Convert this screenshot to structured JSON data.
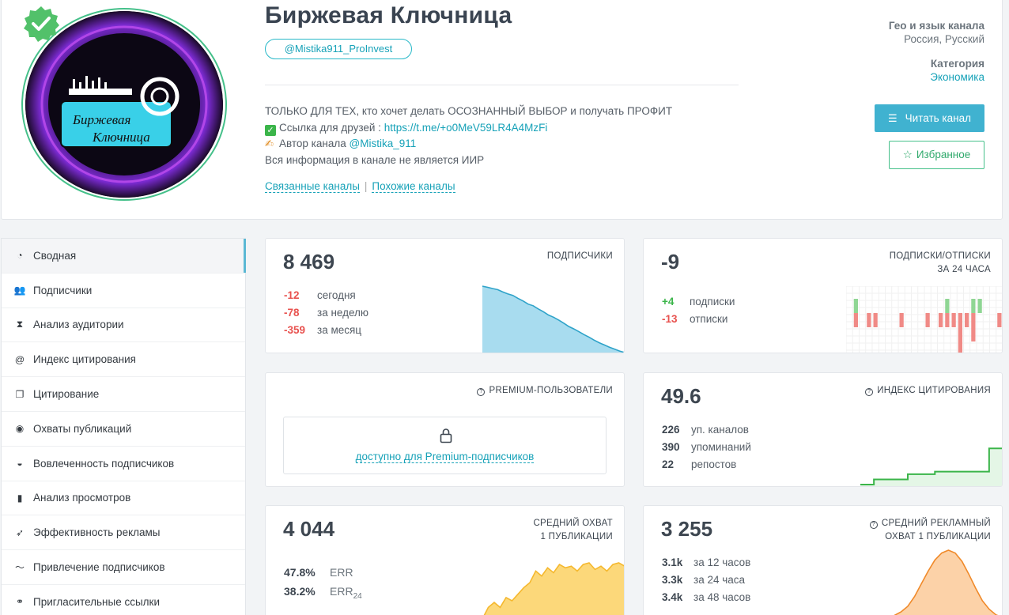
{
  "channel": {
    "title": "Биржевая Ключница",
    "username": "@Mistika911_ProInvest",
    "avatar_text_line1": "Биржевая",
    "avatar_text_line2": "Ключница",
    "description": {
      "line1": "ТОЛЬКО ДЛЯ ТЕХ, кто хочет делать  ОСОЗНАННЫЙ ВЫБОР и получать ПРОФИТ",
      "line2_label": "Ссылка для друзей : ",
      "line2_link": "https://t.me/+o0MeV59LR4A4MzFi",
      "line3_label": "Автор канала ",
      "line3_link": "@Mistika_911",
      "line4": "Вся информация в канале не является ИИР"
    },
    "related_label": "Связанные каналы",
    "similar_label": "Похожие каналы",
    "sep": "|"
  },
  "meta": {
    "geo_label": "Гео и язык канала",
    "geo_value": "Россия, Русский",
    "category_label": "Категория",
    "category_value": "Экономика"
  },
  "buttons": {
    "read": "Читать канал",
    "favorite": "Избранное"
  },
  "sidebar": {
    "items": [
      {
        "label": "Сводная",
        "icon": "dashboard-icon"
      },
      {
        "label": "Подписчики",
        "icon": "users-icon"
      },
      {
        "label": "Анализ аудитории",
        "icon": "hourglass-icon"
      },
      {
        "label": "Индекс цитирования",
        "icon": "at-icon"
      },
      {
        "label": "Цитирование",
        "icon": "quote-icon"
      },
      {
        "label": "Охваты публикаций",
        "icon": "eye-icon"
      },
      {
        "label": "Вовлеченность подписчиков",
        "icon": "engagement-icon"
      },
      {
        "label": "Анализ просмотров",
        "icon": "bar-chart-icon"
      },
      {
        "label": "Эффективность рекламы",
        "icon": "rocket-icon"
      },
      {
        "label": "Привлечение подписчиков",
        "icon": "trend-icon"
      },
      {
        "label": "Пригласительные ссылки",
        "icon": "link-icon"
      }
    ]
  },
  "subscribers": {
    "value": "8 469",
    "caption": "ПОДПИСЧИКИ",
    "rows": [
      {
        "n": "-12",
        "t": "сегодня"
      },
      {
        "n": "-78",
        "t": "за неделю"
      },
      {
        "n": "-359",
        "t": "за месяц"
      }
    ]
  },
  "subs_unsubs": {
    "value": "-9",
    "caption1": "ПОДПИСКИ/ОТПИСКИ",
    "caption2": "ЗА 24 ЧАСА",
    "rows": [
      {
        "n": "+4",
        "t": "подписки"
      },
      {
        "n": "-13",
        "t": "отписки"
      }
    ]
  },
  "premium": {
    "caption": "PREMIUM-ПОЛЬЗОВАТЕЛИ",
    "locked_text": "доступно для Premium-подписчиков"
  },
  "citation": {
    "value": "49.6",
    "caption": "ИНДЕКС ЦИТИРОВАНИЯ",
    "rows": [
      {
        "n": "226",
        "t": "уп. каналов"
      },
      {
        "n": "390",
        "t": "упоминаний"
      },
      {
        "n": "22",
        "t": "репостов"
      }
    ]
  },
  "reach": {
    "value": "4 044",
    "caption1": "СРЕДНИЙ ОХВАТ",
    "caption2": "1 ПУБЛИКАЦИИ",
    "rows": [
      {
        "n": "47.8%",
        "t": "ERR"
      },
      {
        "n": "38.2%",
        "t": "ERR",
        "sub": "24"
      }
    ]
  },
  "ad_reach": {
    "value": "3 255",
    "caption1": "СРЕДНИЙ РЕКЛАМНЫЙ",
    "caption2": "ОХВАТ 1 ПУБЛИКАЦИИ",
    "rows": [
      {
        "n": "3.1k",
        "t": "за 12 часов"
      },
      {
        "n": "3.3k",
        "t": "за 24 часа"
      },
      {
        "n": "3.4k",
        "t": "за 48 часов"
      }
    ]
  },
  "colors": {
    "accent": "#17a2b8",
    "negative": "#e8524f",
    "positive": "#3bb54a",
    "subs_fill": "#a8dcef",
    "reach_fill": "#fcd87a",
    "ad_fill": "#fcd2a8",
    "citation_line": "#3bb54a"
  },
  "chart_data": [
    {
      "type": "area",
      "id": "subscribers-trend",
      "values": [
        8828,
        8822,
        8815,
        8809,
        8797,
        8786,
        8778,
        8762,
        8748,
        8731,
        8722,
        8705,
        8690,
        8672,
        8660,
        8645,
        8628,
        8610,
        8597,
        8582,
        8566,
        8552,
        8536,
        8522,
        8510,
        8498,
        8488,
        8477,
        8469
      ]
    },
    {
      "type": "bar",
      "id": "subs-unsubs-24h",
      "positive": [
        0,
        1,
        0,
        0,
        0,
        0,
        0,
        0,
        0,
        0,
        0,
        0,
        0,
        0,
        0,
        1,
        0,
        0,
        0,
        1,
        1,
        0,
        0,
        0
      ],
      "negative": [
        0,
        1,
        0,
        1,
        1,
        0,
        0,
        0,
        1,
        0,
        0,
        0,
        1,
        0,
        1,
        1,
        1,
        3,
        1,
        2,
        0,
        0,
        0,
        1
      ]
    },
    {
      "type": "line",
      "id": "citation-index",
      "values": [
        47.0,
        47.0,
        47.2,
        47.2,
        47.2,
        47.2,
        47.2,
        47.4,
        47.4,
        47.4,
        47.4,
        47.5,
        47.5,
        47.5,
        47.5,
        47.5,
        47.5,
        47.5,
        47.5,
        48.4,
        48.4,
        49.6
      ]
    },
    {
      "type": "area",
      "id": "reach-hourly",
      "values": [
        2,
        9,
        12,
        9,
        15,
        13,
        17,
        21,
        24,
        31,
        28,
        33,
        30,
        35,
        33,
        34,
        31,
        35,
        36,
        32,
        34,
        31,
        35,
        36,
        34
      ]
    },
    {
      "type": "area",
      "id": "ad-reach-curve",
      "values": [
        0,
        0.1,
        0.3,
        0.6,
        1.2,
        2.5,
        5,
        9,
        16,
        25,
        34,
        42,
        47,
        49,
        47,
        41,
        32,
        22,
        13,
        7,
        3,
        1
      ]
    }
  ]
}
